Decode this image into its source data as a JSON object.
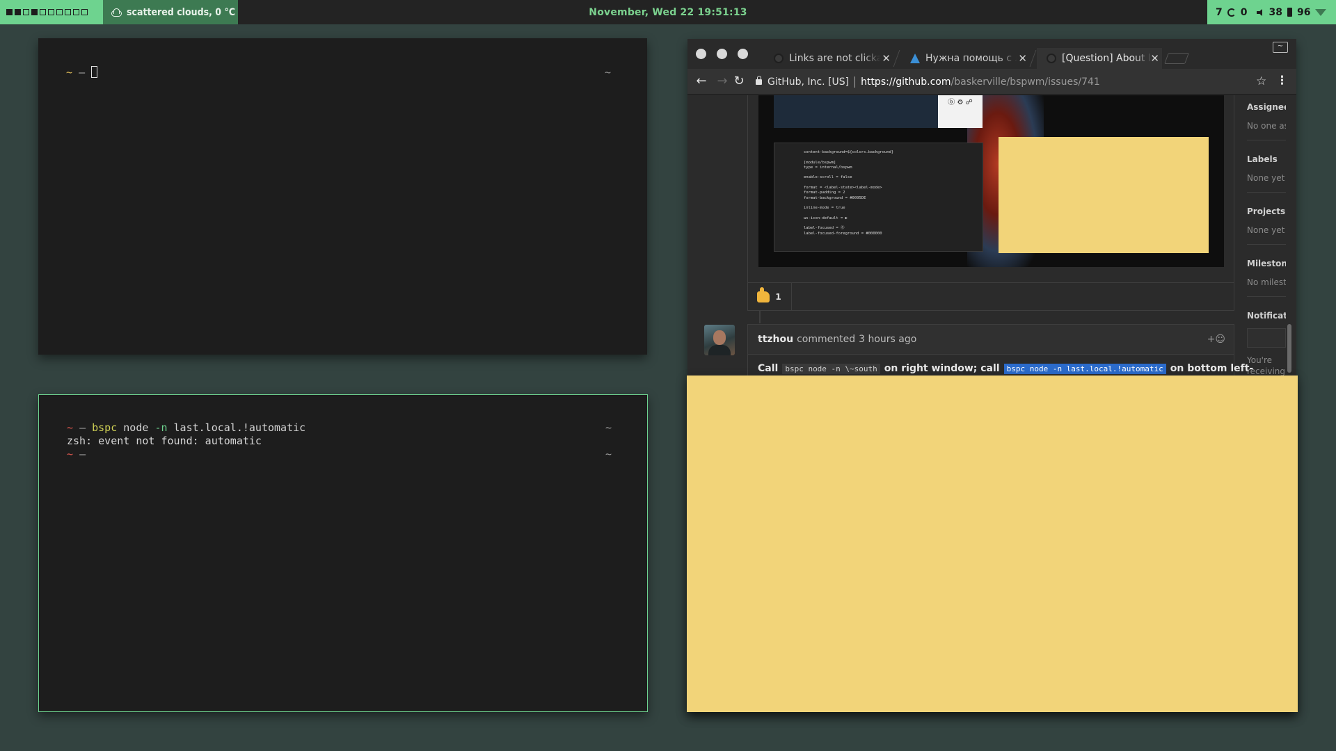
{
  "topbar": {
    "workspaces": [
      "1",
      "2",
      "3",
      "4",
      "5",
      "6",
      "7",
      "8",
      "9",
      "10"
    ],
    "weather": "scattered clouds, 0 °C",
    "clock": "November, Wed 22 19:51:13",
    "status": {
      "updates": "7",
      "sync": "0",
      "volume": "38",
      "battery": "96"
    },
    "colors": {
      "accent": "#6ed38f",
      "weather_bg": "#3d7a52",
      "bar_bg": "#232323"
    }
  },
  "terminal1": {
    "prompt_tilde": "~",
    "prompt_dash": "–",
    "right_marker": "~"
  },
  "terminal2": {
    "line1": {
      "tilde": "~",
      "dash": "–",
      "cmd": "bspc",
      "arg1": " node ",
      "flag": "-n",
      "arg2": " last.local.!automatic",
      "right": "~"
    },
    "line2": "zsh: event not found: automatic",
    "line3": {
      "tilde": "~",
      "dash": "–",
      "right": "~"
    }
  },
  "browser": {
    "tabs": [
      {
        "title": "Links are not clickable",
        "icon": "github-icon"
      },
      {
        "title": "Нужна помощь с ломом",
        "icon": "arch-icon"
      },
      {
        "title": "[Question] About layouts",
        "icon": "github-icon",
        "active": true
      }
    ],
    "window_button": "~",
    "security_label": "GitHub, Inc. [US]",
    "url_scheme_host": "https://github.com",
    "url_path": "/baskerville/bspwm/issues/741",
    "embedded_white_text": "ⓑ ⚙ ☍",
    "embedded_code": "content-background=${colors.background}\n\n[module/bspwm]\ntype = internal/bspwm\n\nenable-scroll = false\n\nformat = <label-state><label-mode>\nformat-padding = 2\nformat-background = #0095DE\n\ninline-mode = true\n\nws-icon-default = ▶\n\nlabel-focused = ⓪\nlabel-focused-foreground = #000000",
    "reaction": {
      "emoji": "thumbs-up",
      "count": "1"
    },
    "comment": {
      "author": "ttzhou",
      "action": "commented",
      "time": "3 hours ago",
      "emoji_button": "+☺",
      "body_start": "Call",
      "code1": "bspc node -n \\~south",
      "body_mid": "on right window; call",
      "code2": "bspc node -n last.local.!automatic",
      "body_end": "on bottom left-"
    },
    "sidebar": {
      "assignees_heading": "Assignees",
      "assignees_value": "No one assigned",
      "labels_heading": "Labels",
      "labels_value": "None yet",
      "projects_heading": "Projects",
      "projects_value": "None yet",
      "milestone_heading": "Milestone",
      "milestone_value": "No milestone",
      "notifications_heading": "Notifications",
      "notifications_text": "You're receiving notifications because"
    }
  }
}
